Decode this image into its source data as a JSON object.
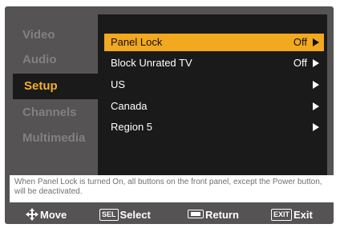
{
  "sidebar": {
    "items": [
      {
        "label": "Video",
        "active": false
      },
      {
        "label": "Audio",
        "active": false
      },
      {
        "label": "Setup",
        "active": true
      },
      {
        "label": "Channels",
        "active": false
      },
      {
        "label": "Multimedia",
        "active": false
      }
    ]
  },
  "menu": {
    "rows": [
      {
        "label": "Panel Lock",
        "value": "Off",
        "selected": true,
        "has_arrow": true
      },
      {
        "label": "Block Unrated TV",
        "value": "Off",
        "selected": false,
        "has_arrow": true
      },
      {
        "label": "US",
        "value": "",
        "selected": false,
        "has_arrow": true
      },
      {
        "label": "Canada",
        "value": "",
        "selected": false,
        "has_arrow": true
      },
      {
        "label": "Region 5",
        "value": "",
        "selected": false,
        "has_arrow": true
      }
    ]
  },
  "help": {
    "text": "When Panel Lock is turned On, all buttons on the front panel, except the Power button, will be deactivated."
  },
  "footer": {
    "move_label": "Move",
    "select_key": "SEL",
    "select_label": "Select",
    "return_label": "Return",
    "exit_key": "EXIT",
    "exit_label": "Exit"
  },
  "colors": {
    "frame": "#555353",
    "panel": "#1a1a1a",
    "highlight": "#f2a81f",
    "active_sidebar_text": "#f0b030",
    "inactive_sidebar_text": "#818181",
    "help_background": "#ffffff",
    "help_text": "#707070"
  }
}
